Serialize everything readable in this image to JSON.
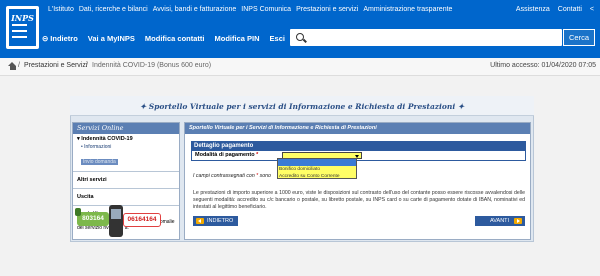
{
  "topnav": {
    "items": [
      "L'Istituto",
      "Dati, ricerche e bilanci",
      "Avvisi, bandi e fatturazione",
      "INPS Comunica",
      "Prestazioni e servizi",
      "Amministrazione trasparente"
    ],
    "right": [
      "Assistenza",
      "Contatti"
    ],
    "logo_text": "INPS"
  },
  "secnav": {
    "items": [
      "Indietro",
      "Vai a MyINPS",
      "Modifica contatti",
      "Modifica PIN",
      "Esci"
    ]
  },
  "search": {
    "placeholder": "",
    "button": "Cerca"
  },
  "breadcrumb": {
    "parent": "Prestazioni e Servizi",
    "current": "Indennità COVID-19 (Bonus 600 euro)",
    "last_access": "Ultimo accesso: 01/04/2020 07:05"
  },
  "frame": {
    "title": "Sportello Virtuale per i servizi di Informazione e Richiesta di Prestazioni"
  },
  "sidebar": {
    "title": "Servizi Online",
    "section": "Indennità COVID-19",
    "sub1": "Informazioni",
    "sub2": "Invio domanda",
    "altri": "Altri servizi",
    "uscita": "Uscita",
    "contatti_title": "Contatti",
    "contatti_text": "Per segnalare malfunzionamenti e anomalie del servizio rivolgersi a:",
    "num1": "803164",
    "num2": "06164164"
  },
  "main": {
    "header": "Sportello Virtuale per i Servizi di Informazione e Richiesta di Prestazioni",
    "detail_title": "Dettaglio pagamento",
    "field_label": "Modalità di pagamento",
    "req_mark": "*",
    "dropdown": [
      "Bonifico domiciliato",
      "Accredito su Conto Corrente"
    ],
    "note_pre": "I campi contrassegnati con",
    "note_mark": "*",
    "note_post": "sono",
    "body": "Le prestazioni di importo superiore a 1000 euro, viste le disposizioni sul contrasto dell'uso del contante posso essere riscosse avvalendosi delle seguenti modalità: accredito su c/c bancario o postale, su libretto postale, su INPS card o su carte di pagamento dotate di IBAN, nominativi ed intestati al legittimo beneficiario.",
    "back": "INDIETRO",
    "next": "AVANTI"
  }
}
